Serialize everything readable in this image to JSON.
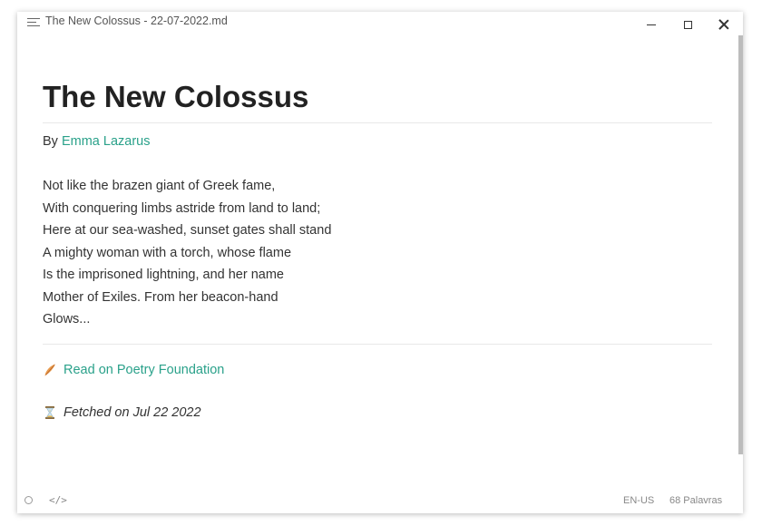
{
  "window": {
    "title": "The New Colossus - 22-07-2022.md"
  },
  "document": {
    "heading": "The New Colossus",
    "byline_prefix": "By ",
    "author": "Emma Lazarus",
    "poem_lines": [
      "Not like the brazen giant of Greek fame,",
      "With conquering limbs astride from land to land;",
      "Here at our sea-washed, sunset gates shall stand",
      "A mighty woman with a torch, whose flame",
      "Is the imprisoned lightning, and her name",
      "Mother of Exiles. From her beacon-hand",
      "Glows..."
    ],
    "source_link": "Read on Poetry Foundation",
    "source_icon": "feather-icon",
    "fetched_text": "Fetched on Jul 22 2022",
    "fetched_icon": "hourglass-icon"
  },
  "statusbar": {
    "code_glyph": "</>",
    "language": "EN-US",
    "word_count": "68 Palavras"
  },
  "colors": {
    "link": "#2aa18a",
    "text": "#333333",
    "heading": "#222222",
    "scrollbar": "#bcbcbc"
  }
}
